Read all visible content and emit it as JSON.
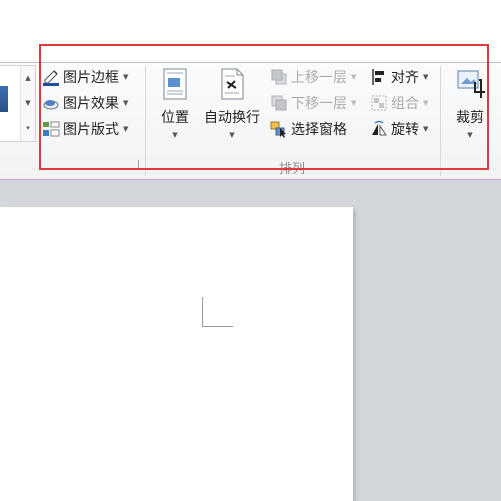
{
  "format_group": {
    "picture_border": "图片边框",
    "picture_effects": "图片效果",
    "picture_layout": "图片版式"
  },
  "arrange_group": {
    "label": "排列",
    "position": "位置",
    "wrap_text": "自动换行",
    "bring_forward": "上移一层",
    "send_backward": "下移一层",
    "selection_pane": "选择窗格",
    "align": "对齐",
    "group": "组合",
    "rotate": "旋转"
  },
  "size_group": {
    "crop": "裁剪"
  },
  "colors": {
    "highlight_border": "#e03a3a",
    "ribbon_background": "#f1f3f5",
    "workspace_background": "#d3d6da"
  }
}
